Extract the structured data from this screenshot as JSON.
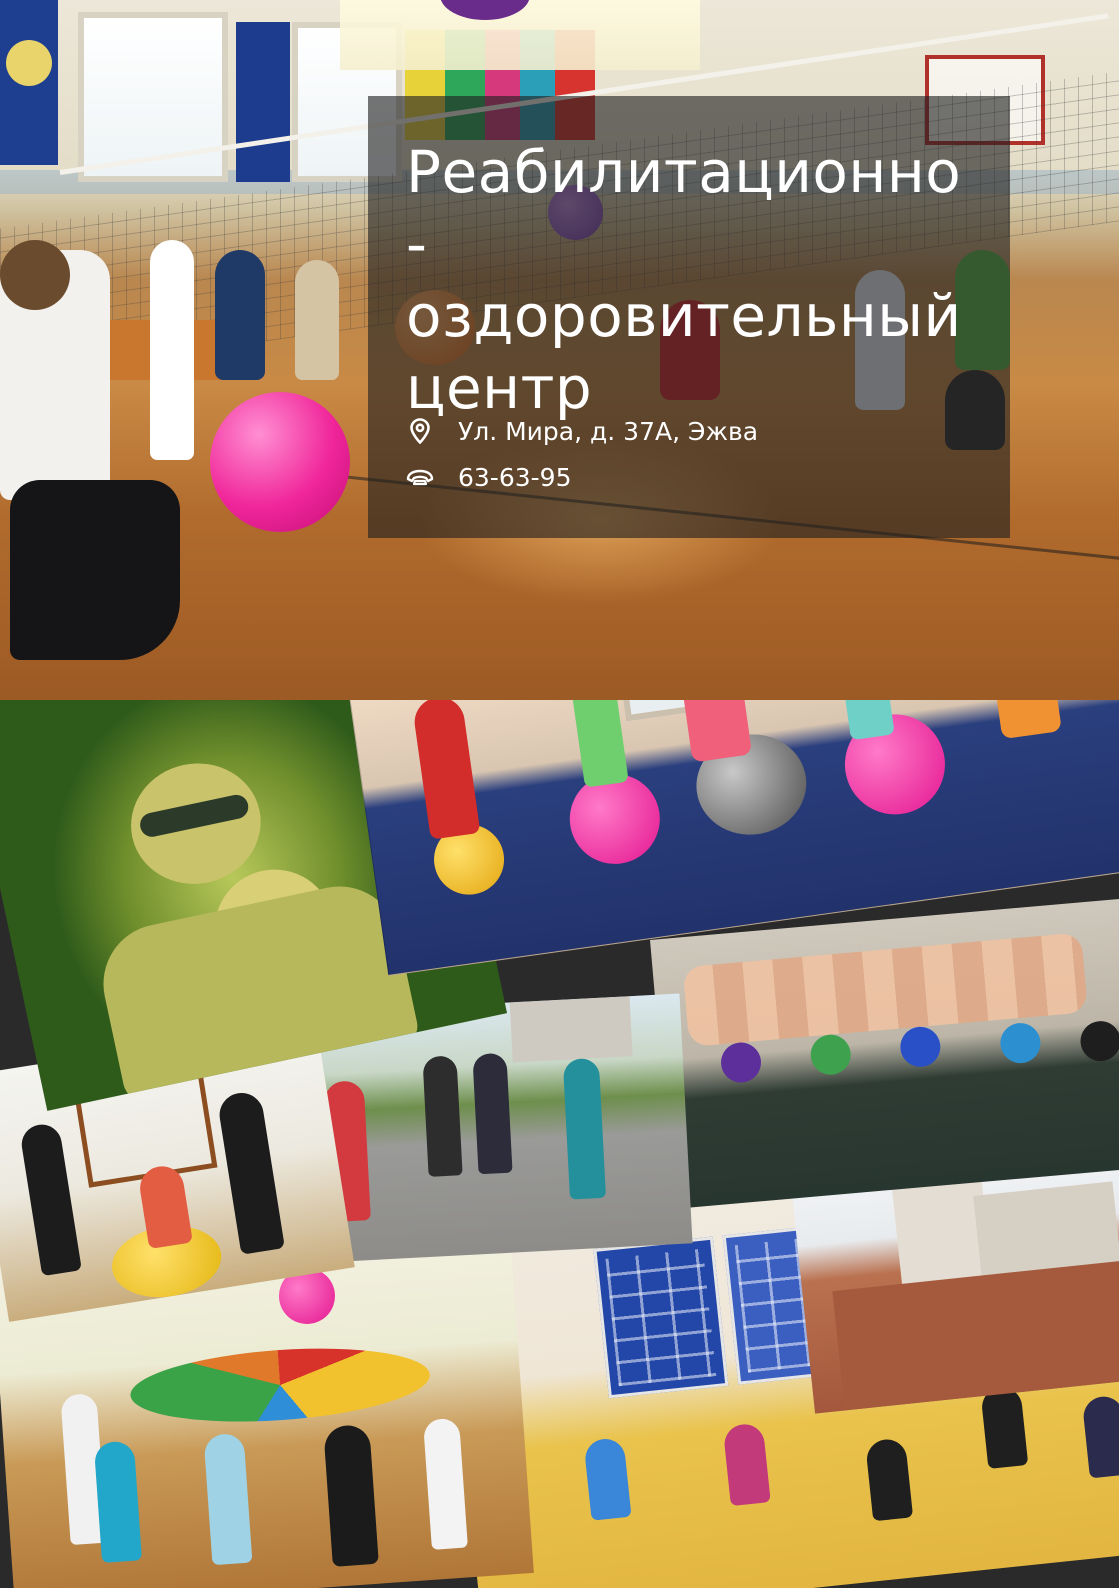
{
  "card": {
    "title": "Реабилитационно -\nоздоровительный\nцентр",
    "address": "Ул. Мира, д. 37А, Эжва",
    "phone": "63-63-95",
    "address_icon": "location-pin-icon",
    "phone_icon": "phone-icon"
  },
  "photos": [
    "gym-volleyball-photo",
    "fitball-room-photo",
    "swimming-baby-photo",
    "kids-fitball-photo",
    "outdoor-exercise-photo",
    "baby-pool-photo",
    "building-photo",
    "parachute-game-photo",
    "fitness-hall-photo"
  ],
  "colors": {
    "card_bg": "#202020",
    "text": "#ffffff"
  }
}
